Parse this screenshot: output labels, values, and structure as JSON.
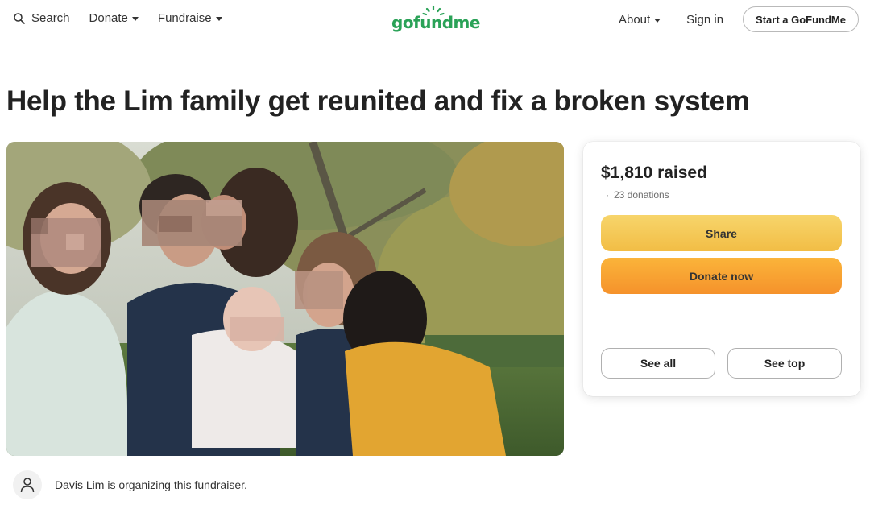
{
  "header": {
    "search_label": "Search",
    "donate_label": "Donate",
    "fundraise_label": "Fundraise",
    "logo_text": "gofundme",
    "about_label": "About",
    "signin_label": "Sign in",
    "start_label": "Start a GoFundMe"
  },
  "campaign": {
    "title": "Help the Lim family get reunited and fix a broken system",
    "hero_image": "family-photo-outdoors"
  },
  "donation_card": {
    "raised": "$1,810 raised",
    "donation_dot": "·",
    "donations": "23 donations",
    "share_label": "Share",
    "donate_label": "Donate now",
    "see_all_label": "See all",
    "see_top_label": "See top"
  },
  "organizer": {
    "text": "Davis Lim is organizing this fundraiser.",
    "avatar_icon": "person-icon"
  },
  "colors": {
    "brand_green": "#2aa257",
    "share_yellow": "#f2bd45",
    "donate_orange": "#f5922b"
  }
}
